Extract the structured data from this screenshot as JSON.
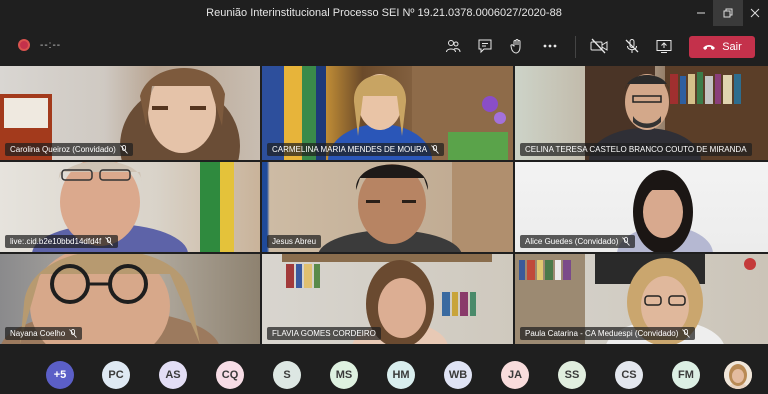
{
  "window": {
    "title": "Reunião Interinstitucional Processo SEI Nº 19.21.0378.0006027/2020-88"
  },
  "toolbar": {
    "timer": "--:--",
    "leave_label": "Sair"
  },
  "participants": [
    {
      "name": "Carolina Queiroz (Convidado)"
    },
    {
      "name": "CARMELINA MARIA MENDES DE MOURA"
    },
    {
      "name": "CELINA TERESA CASTELO BRANCO COUTO DE MIRANDA"
    },
    {
      "name": "live:.cid.b2e10bbd14dfd4f"
    },
    {
      "name": "Jesus Abreu"
    },
    {
      "name": "Alice Guedes (Convidado)"
    },
    {
      "name": "Nayana Coelho"
    },
    {
      "name": "FLAVIA GOMES CORDEIRO"
    },
    {
      "name": "Paula Catarina - CA Meduespi (Convidado)"
    }
  ],
  "strip": {
    "more": "+5",
    "avatars": [
      {
        "initials": "PC",
        "color": "#dfe9f3"
      },
      {
        "initials": "AS",
        "color": "#e3def5"
      },
      {
        "initials": "CQ",
        "color": "#f7dde6"
      },
      {
        "initials": "S",
        "color": "#dde7e3"
      },
      {
        "initials": "MS",
        "color": "#def1e0"
      },
      {
        "initials": "HM",
        "color": "#d9eeee"
      },
      {
        "initials": "WB",
        "color": "#dfe3f4"
      },
      {
        "initials": "JA",
        "color": "#f8dcdc"
      },
      {
        "initials": "SS",
        "color": "#e1eedf"
      },
      {
        "initials": "CS",
        "color": "#e3e7ee"
      },
      {
        "initials": "FM",
        "color": "#dcefe4"
      }
    ]
  },
  "colors": {
    "leave": "#c4314b",
    "more_bg": "#5b5fc7"
  }
}
